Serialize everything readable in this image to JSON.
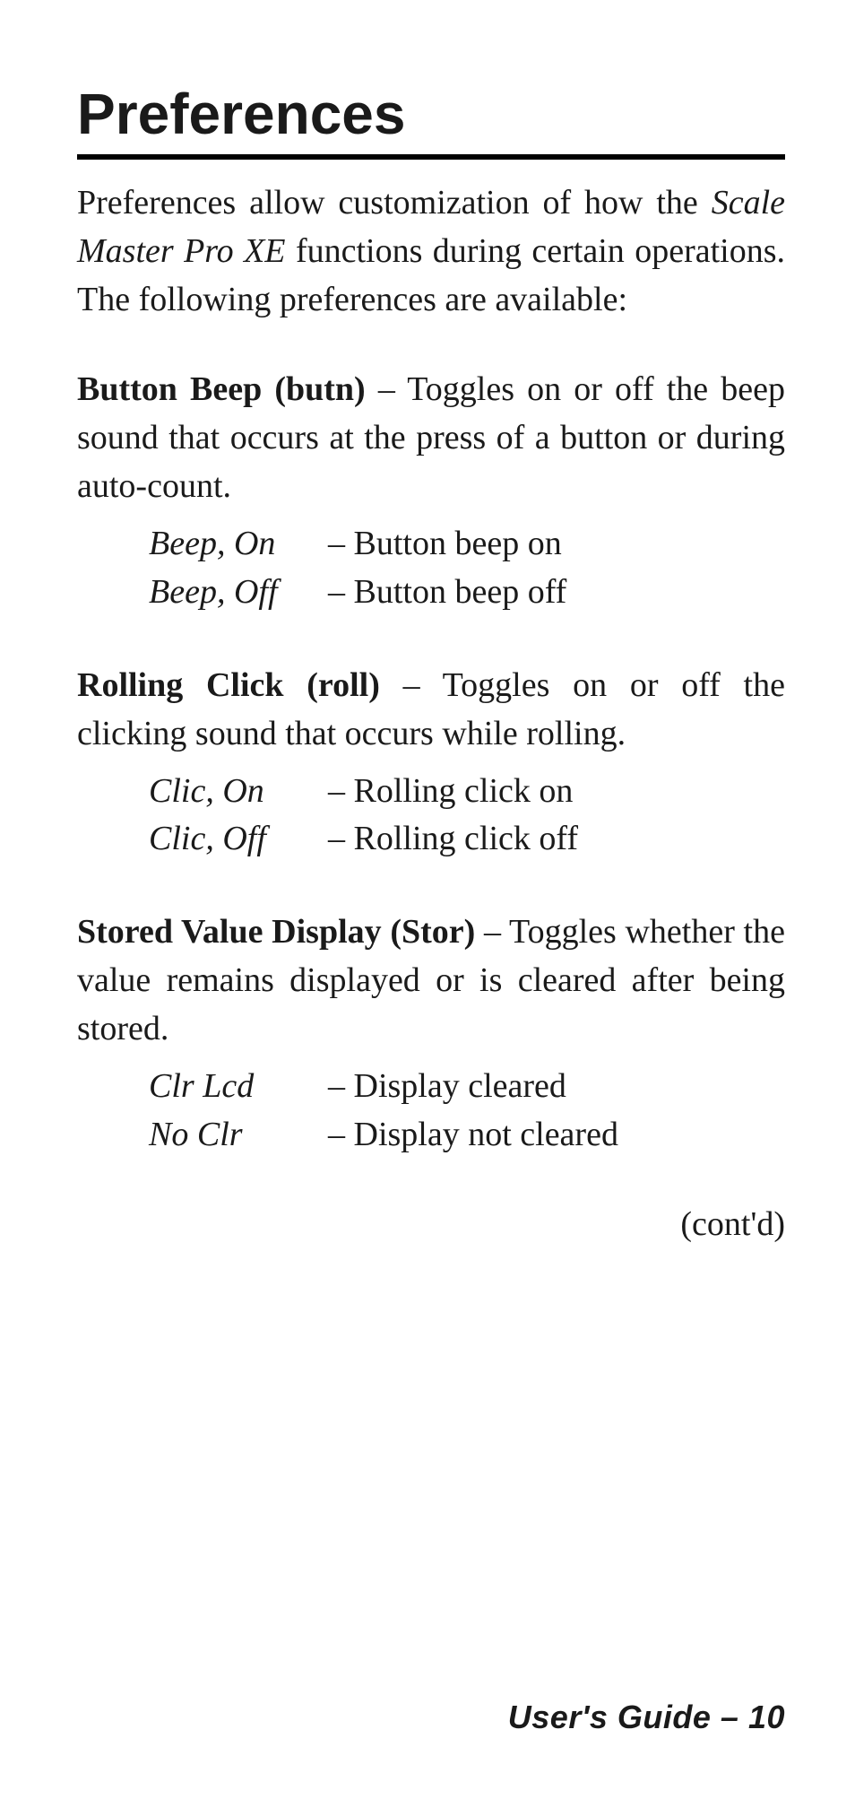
{
  "title": "Preferences",
  "intro_pre": "Preferences allow customization of how the ",
  "product_name": "Scale Master Pro XE",
  "intro_post": " functions during certain operations. The following preferences are available:",
  "prefs": [
    {
      "heading": "Button Beep (butn)",
      "desc": " – Toggles on or off the beep sound that occurs at the press of a button or during auto-count.",
      "options": [
        {
          "key": "Beep, On",
          "val": "– Button beep on"
        },
        {
          "key": "Beep, Off",
          "val": "– Button beep off"
        }
      ]
    },
    {
      "heading": "Rolling Click (roll)",
      "desc": " – Toggles on or off the clicking sound that occurs while rolling.",
      "options": [
        {
          "key": "Clic, On",
          "val": "– Rolling click on"
        },
        {
          "key": "Clic, Off",
          "val": "– Rolling click off"
        }
      ]
    },
    {
      "heading": "Stored Value Display (Stor)",
      "desc": " – Toggles whether the value remains displayed or is cleared after being stored.",
      "options": [
        {
          "key": "Clr Lcd",
          "val": "– Display cleared"
        },
        {
          "key": "No Clr",
          "val": "– Display not cleared"
        }
      ]
    }
  ],
  "contd": "(cont'd)",
  "footer": "User's Guide – 10"
}
